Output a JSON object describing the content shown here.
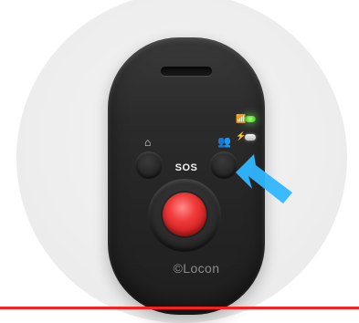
{
  "device": {
    "sos_label": "SOS",
    "logo_text": "©Locon"
  },
  "icons": {
    "home": "home-icon",
    "contacts": "contacts-icon",
    "signal": "signal-icon",
    "charging": "charging-icon",
    "arrow": "pointer-arrow-icon"
  },
  "colors": {
    "sos_red": "#e22b2b",
    "led_green": "#6cff4a",
    "arrow_blue": "#2fb6ff",
    "bottom_rule": "#ff1e1e"
  }
}
